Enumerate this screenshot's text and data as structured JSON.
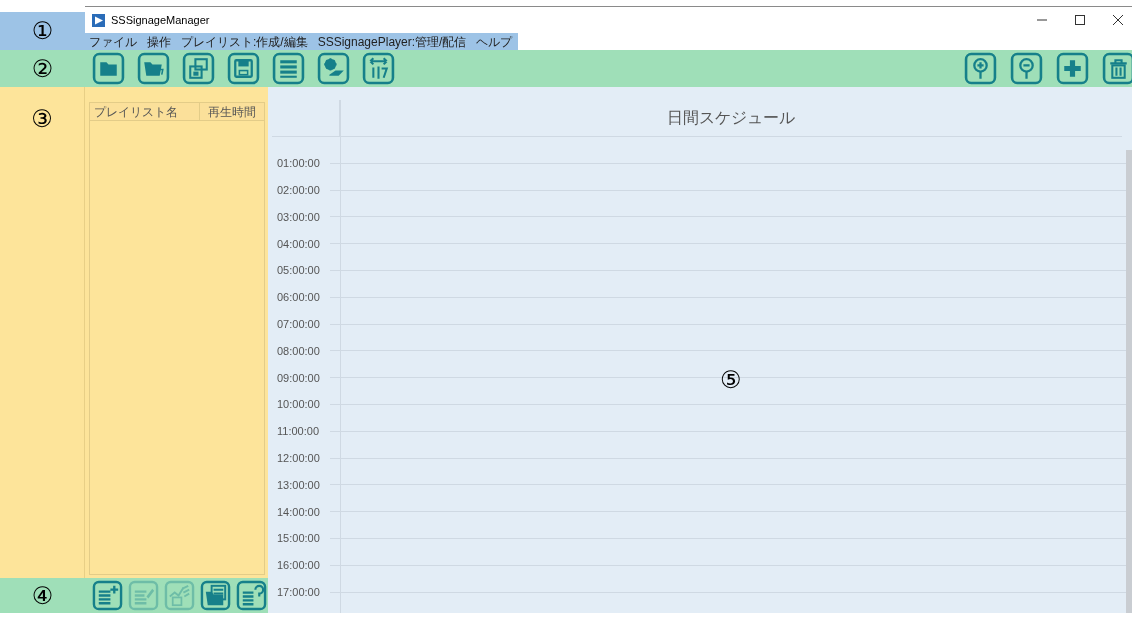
{
  "annotations": [
    "①",
    "②",
    "③",
    "④",
    "⑤"
  ],
  "window": {
    "title": "SSSignageManager"
  },
  "menu": [
    "ファイル",
    "操作",
    "プレイリスト:作成/編集",
    "SSSignagePlayer:管理/配信",
    "ヘルプ"
  ],
  "playlist_table": {
    "columns": [
      "プレイリスト名",
      "再生時間"
    ]
  },
  "playlist_toolbar": [
    {
      "disabled": false
    },
    {
      "disabled": true
    },
    {
      "disabled": true
    },
    {
      "disabled": false
    },
    {
      "disabled": false
    }
  ],
  "schedule": {
    "title": "日間スケジュール",
    "times": [
      "01:00:00",
      "02:00:00",
      "03:00:00",
      "04:00:00",
      "05:00:00",
      "06:00:00",
      "07:00:00",
      "08:00:00",
      "09:00:00",
      "10:00:00",
      "11:00:00",
      "12:00:00",
      "13:00:00",
      "14:00:00",
      "15:00:00",
      "16:00:00",
      "17:00:00"
    ]
  }
}
